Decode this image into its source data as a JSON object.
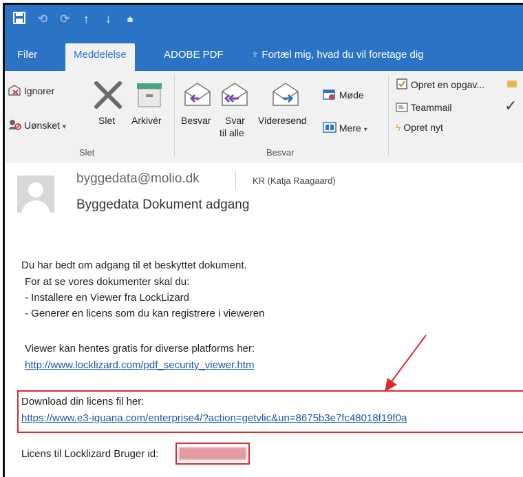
{
  "quick_access": {
    "save_icon": "save-icon",
    "undo_icon": "undo-icon",
    "redo_icon": "redo-icon",
    "up_icon": "arrow-up-icon",
    "down_icon": "arrow-down-icon",
    "customize_icon": "customize-icon"
  },
  "tabs": {
    "filer": "Filer",
    "meddelelse": "Meddelelse",
    "adobe_pdf": "ADOBE PDF",
    "tell_me": "Fortæl mig, hvad du vil foretage dig"
  },
  "ribbon": {
    "delete_group": {
      "ignorer": "Ignorer",
      "uonsket": "Uønsket",
      "slet": "Slet",
      "arkiver": "Arkivér",
      "label": "Slet"
    },
    "respond_group": {
      "besvar": "Besvar",
      "svar_line1": "Svar",
      "svar_line2": "til alle",
      "videresend": "Videresend",
      "mode": "Møde",
      "mere": "Mere",
      "label": "Besvar"
    },
    "quick_steps": {
      "opret_opgave": "Opret en opgav...",
      "teammail": "Teammail",
      "opret_nyt": "Opret nyt"
    }
  },
  "email": {
    "sender": "byggedata@molio.dk",
    "recipient": "KR (Katja Raagaard)",
    "subject": "Byggedata Dokument adgang",
    "body": {
      "line1": "Du har bedt om adgang til et beskyttet dokument.",
      "line2": "For at se vores dokumenter skal du:",
      "line3": "- Installere en Viewer fra LockLizard",
      "line4": "- Generer en licens som du kan registrere i vieweren",
      "line5": "Viewer kan hentes gratis for diverse platforms her:",
      "link1": "http://www.locklizard.com/pdf_security_viewer.htm",
      "line6": "Download din licens fil her:",
      "link2": "https://www.e3-iguana.com/enterprise4/?action=getvlic&un=8675b3e7fc48018f19f0a",
      "line7": "Licens til Locklizard Bruger id:"
    }
  },
  "annotation_color": "#e0282a"
}
